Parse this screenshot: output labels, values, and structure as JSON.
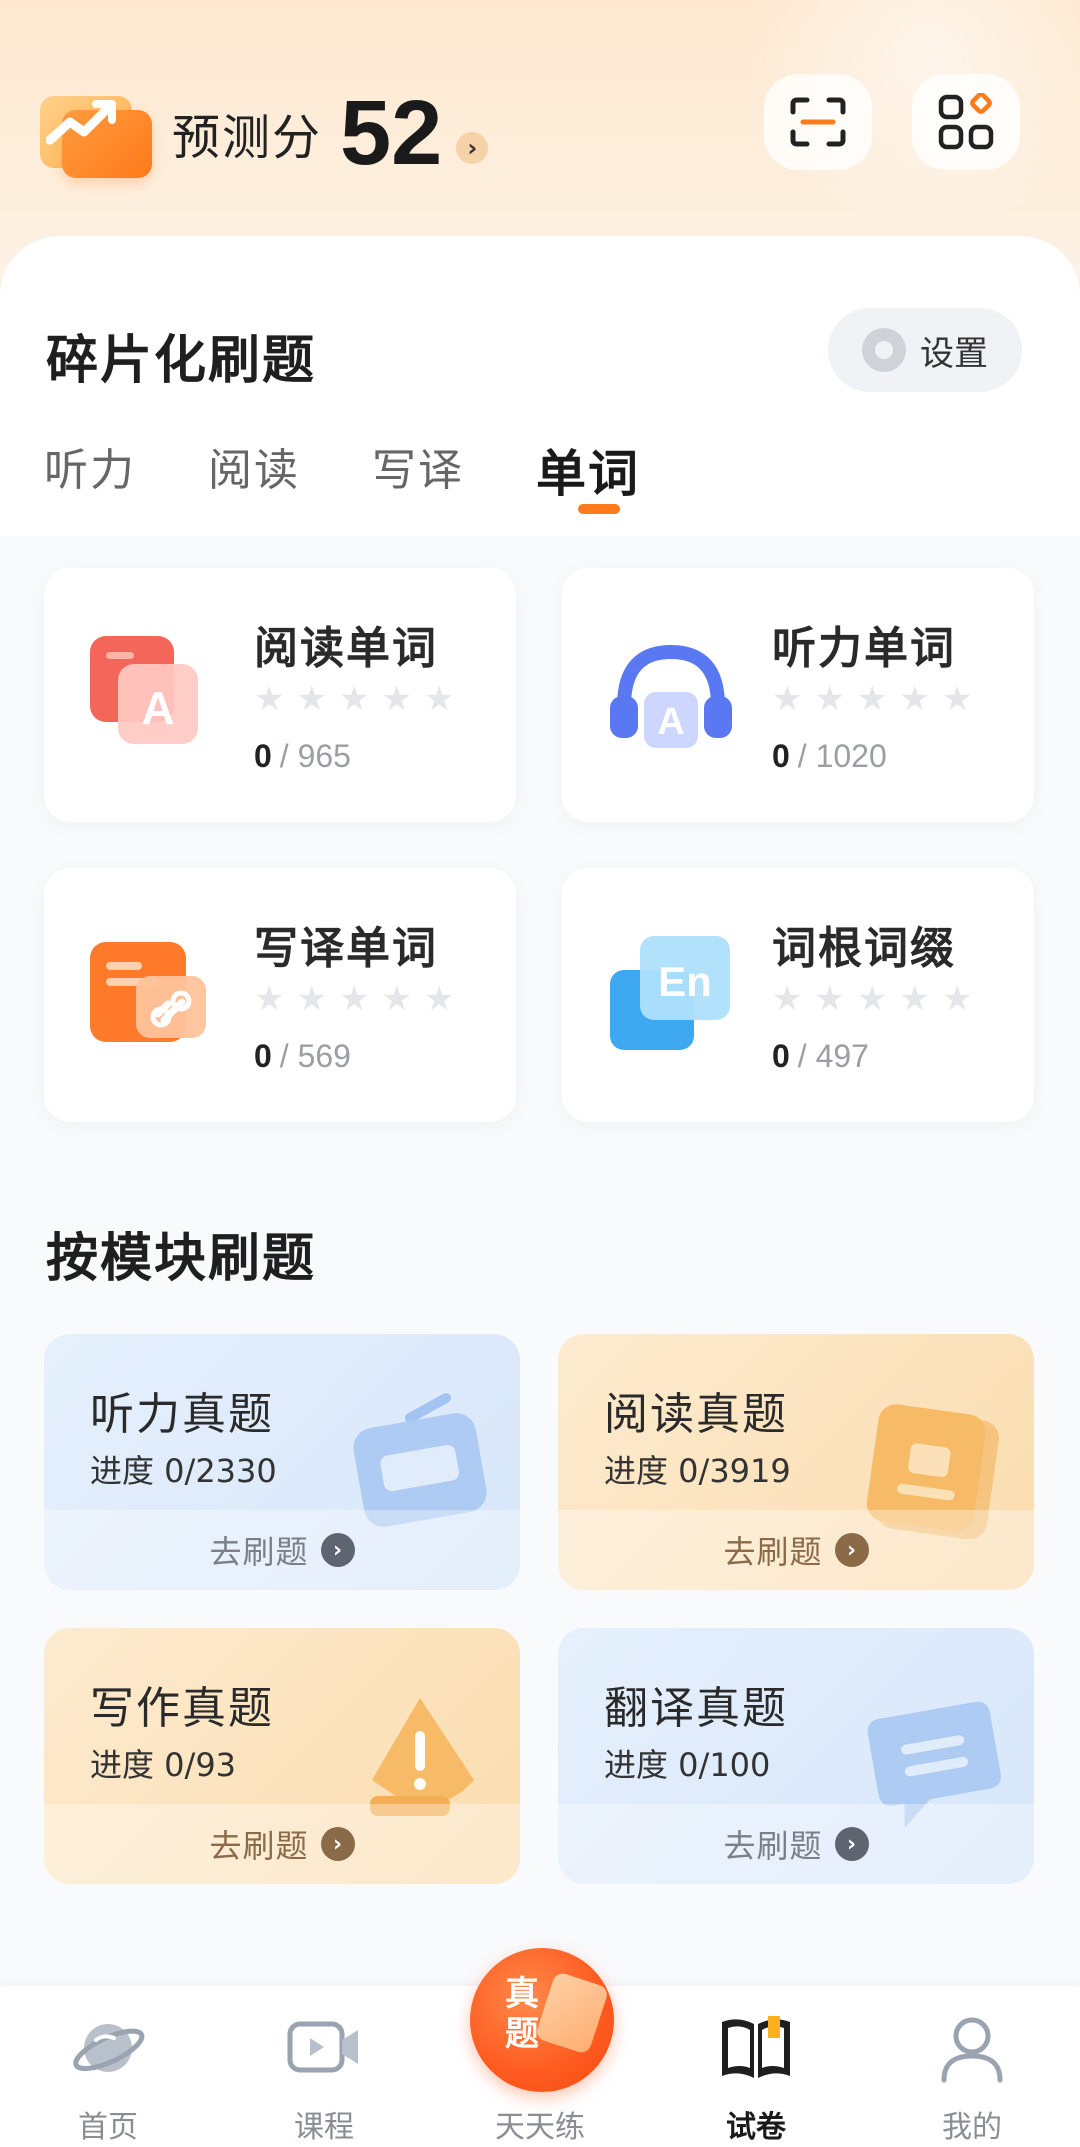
{
  "header": {
    "score_label": "预测分",
    "score_value": "52",
    "score_arrow": "›",
    "scan_icon": "scan-icon",
    "apps_icon": "apps-grid-icon"
  },
  "fragment_section": {
    "title": "碎片化刷题",
    "settings_label": "设置",
    "tabs": [
      {
        "label": "听力",
        "active": false
      },
      {
        "label": "阅读",
        "active": false
      },
      {
        "label": "写译",
        "active": false
      },
      {
        "label": "单词",
        "active": true
      }
    ],
    "cards": [
      {
        "title": "阅读单词",
        "done": "0",
        "total": "/ 965",
        "stars": 5,
        "filled": 0,
        "icon": "reading-words-icon"
      },
      {
        "title": "听力单词",
        "done": "0",
        "total": "/ 1020",
        "stars": 5,
        "filled": 0,
        "icon": "listening-words-icon"
      },
      {
        "title": "写译单词",
        "done": "0",
        "total": "/ 569",
        "stars": 5,
        "filled": 0,
        "icon": "writing-words-icon"
      },
      {
        "title": "词根词缀",
        "done": "0",
        "total": "/ 497",
        "stars": 5,
        "filled": 0,
        "icon": "word-roots-icon"
      }
    ]
  },
  "module_section": {
    "title": "按模块刷题",
    "cards": [
      {
        "title": "听力真题",
        "progress": "进度 0/2330",
        "action": "去刷题",
        "theme": "blue",
        "icon": "radio-icon"
      },
      {
        "title": "阅读真题",
        "progress": "进度 0/3919",
        "action": "去刷题",
        "theme": "orange",
        "icon": "book-icon"
      },
      {
        "title": "写作真题",
        "progress": "进度 0/93",
        "action": "去刷题",
        "theme": "orange",
        "icon": "pen-icon"
      },
      {
        "title": "翻译真题",
        "progress": "进度 0/100",
        "action": "去刷题",
        "theme": "blue",
        "icon": "chat-icon"
      }
    ]
  },
  "bottom_nav": {
    "items": [
      {
        "label": "首页",
        "icon": "planet-icon",
        "active": false
      },
      {
        "label": "课程",
        "icon": "video-icon",
        "active": false
      },
      {
        "label": "天天练",
        "icon": "daily-practice-icon",
        "active": false
      },
      {
        "label": "试卷",
        "icon": "exam-book-icon",
        "active": true
      },
      {
        "label": "我的",
        "icon": "profile-icon",
        "active": false
      }
    ],
    "fab_text": "真题"
  },
  "colors": {
    "accent": "#ff7a1a",
    "blue_card": "#dbe8fb",
    "orange_card": "#fbe1b8"
  }
}
